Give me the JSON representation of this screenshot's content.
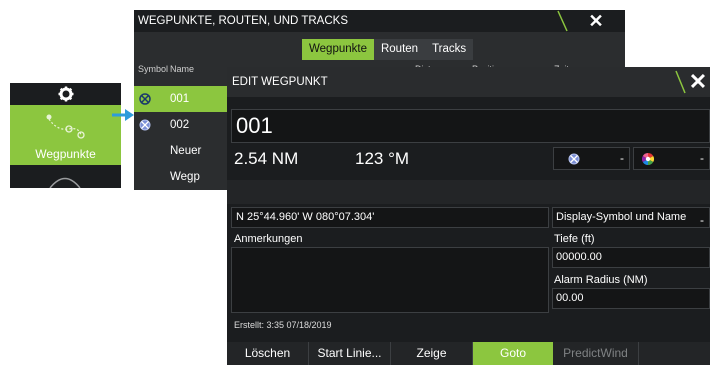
{
  "sidebar": {
    "icon_top": "gear-icon",
    "tile_label": "Wegpunkte",
    "tile_icon": "waypoints-icon"
  },
  "bg_window": {
    "title": "WEGPUNKTE, ROUTEN, UND TRACKS",
    "close_icon": "close-icon",
    "tabs": [
      {
        "label": "Wegpunkte",
        "active": true
      },
      {
        "label": "Routen",
        "active": false
      },
      {
        "label": "Tracks",
        "active": false
      }
    ],
    "headers": {
      "symbol": "Symbol",
      "name": "Name",
      "distanz": "Distanz",
      "position": "Position",
      "zeit": "Zeit"
    },
    "rows": [
      {
        "name": "001",
        "selected": true,
        "icon": "waypoint-icon"
      },
      {
        "name": "002",
        "selected": false,
        "icon": "waypoint-icon"
      },
      {
        "name": "Neuer Wegp",
        "selected": false,
        "icon": ""
      }
    ]
  },
  "fg_window": {
    "title": "EDIT WEGPUNKT",
    "close_icon": "close-icon",
    "name": "001",
    "distance": "2.54 NM",
    "bearing": "123 °M",
    "symbol_icon": "waypoint-icon",
    "color_icon": "color-wheel-icon",
    "dropdown_dash": "-",
    "coords": "N 25°44.960'   W 080°07.304'",
    "display_option": "Display-Symbol und Name",
    "notes_label": "Anmerkungen",
    "depth_label": "Tiefe (ft)",
    "depth_value": "00000.00",
    "alarm_label": "Alarm Radius (NM)",
    "alarm_value": "00.00",
    "created": "Erstellt: 3:35  07/18/2019",
    "buttons": [
      {
        "label": "Löschen",
        "state": "normal"
      },
      {
        "label": "Start Linie...",
        "state": "normal"
      },
      {
        "label": "Zeige",
        "state": "normal"
      },
      {
        "label": "Goto",
        "state": "active"
      },
      {
        "label": "PredictWind",
        "state": "disabled"
      }
    ]
  },
  "colors": {
    "accent": "#8cc63f",
    "panel": "#1b1d1f",
    "field": "#141516",
    "border": "#3c3f42"
  }
}
